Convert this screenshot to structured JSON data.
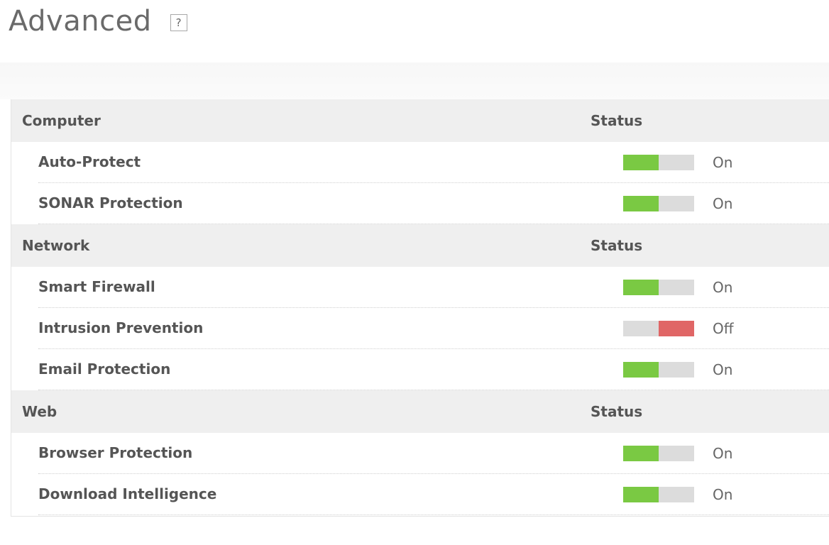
{
  "header": {
    "title": "Advanced",
    "help_label": "?"
  },
  "colors": {
    "on": "#7ac943",
    "off": "#e06666",
    "track": "#dcdcdc",
    "section_bg": "#efefef"
  },
  "sections": [
    {
      "name": "Computer",
      "status_header": "Status",
      "items": [
        {
          "label": "Auto-Protect",
          "state": "On",
          "enabled": true
        },
        {
          "label": "SONAR Protection",
          "state": "On",
          "enabled": true
        }
      ]
    },
    {
      "name": "Network",
      "status_header": "Status",
      "items": [
        {
          "label": "Smart Firewall",
          "state": "On",
          "enabled": true
        },
        {
          "label": "Intrusion Prevention",
          "state": "Off",
          "enabled": false
        },
        {
          "label": "Email Protection",
          "state": "On",
          "enabled": true
        }
      ]
    },
    {
      "name": "Web",
      "status_header": "Status",
      "items": [
        {
          "label": "Browser Protection",
          "state": "On",
          "enabled": true
        },
        {
          "label": "Download Intelligence",
          "state": "On",
          "enabled": true
        }
      ]
    }
  ]
}
